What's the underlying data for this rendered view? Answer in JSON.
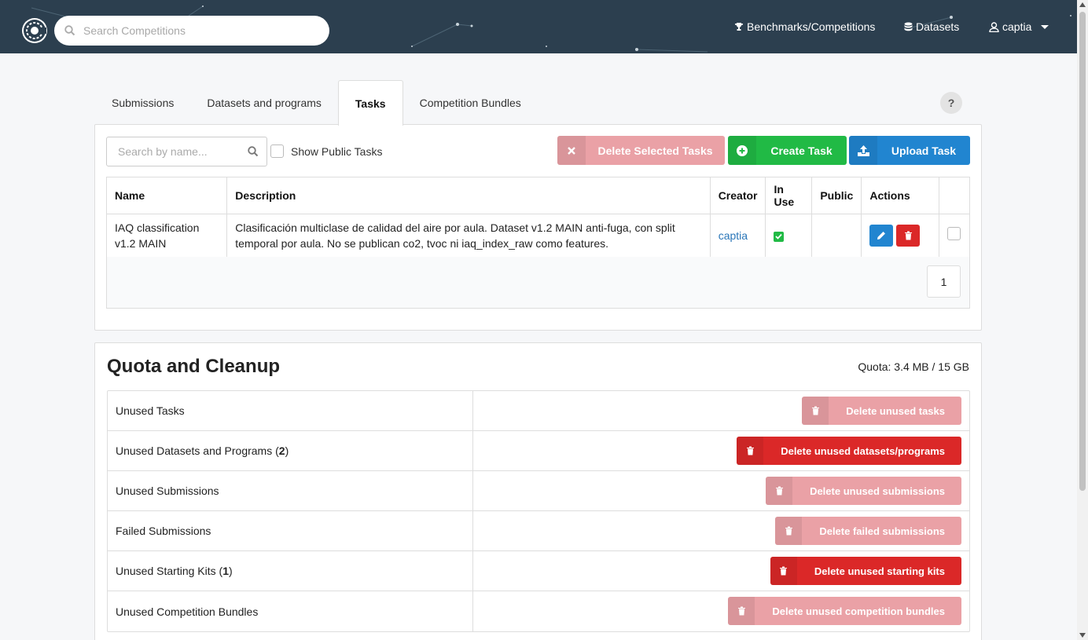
{
  "header": {
    "search_placeholder": "Search Competitions",
    "nav_benchmarks": "Benchmarks/Competitions",
    "nav_datasets": "Datasets",
    "user": "captia"
  },
  "tabs": [
    {
      "label": "Submissions",
      "active": false
    },
    {
      "label": "Datasets and programs",
      "active": false
    },
    {
      "label": "Tasks",
      "active": true
    },
    {
      "label": "Competition Bundles",
      "active": false
    }
  ],
  "help_label": "?",
  "tasks_panel": {
    "search_placeholder": "Search by name...",
    "show_public_label": "Show Public Tasks",
    "show_public_checked": false,
    "delete_selected_label": "Delete Selected Tasks",
    "create_label": "Create Task",
    "upload_label": "Upload Task",
    "columns": [
      "Name",
      "Description",
      "Creator",
      "In Use",
      "Public",
      "Actions"
    ],
    "rows": [
      {
        "name": "IAQ classification v1.2 MAIN",
        "description": "Clasificación multiclase de calidad del aire por aula. Dataset v1.2 MAIN anti-fuga, con split temporal por aula. No se publican co2, tvoc ni iaq_index_raw como features.",
        "creator": "captia",
        "in_use": true,
        "public": false,
        "selected": false
      }
    ],
    "page": "1"
  },
  "quota": {
    "title": "Quota and Cleanup",
    "value": "Quota: 3.4 MB / 15 GB",
    "rows": [
      {
        "label": "Unused Tasks",
        "count": "",
        "button": "Delete unused tasks",
        "enabled": false
      },
      {
        "label": "Unused Datasets and Programs",
        "count": "2",
        "button": "Delete unused datasets/programs",
        "enabled": true
      },
      {
        "label": "Unused Submissions",
        "count": "",
        "button": "Delete unused submissions",
        "enabled": false
      },
      {
        "label": "Failed Submissions",
        "count": "",
        "button": "Delete failed submissions",
        "enabled": false
      },
      {
        "label": "Unused Starting Kits",
        "count": "1",
        "button": "Delete unused starting kits",
        "enabled": true
      },
      {
        "label": "Unused Competition Bundles",
        "count": "",
        "button": "Delete unused competition bundles",
        "enabled": false
      }
    ]
  },
  "colors": {
    "header_bg": "#2c3f4f",
    "green": "#21ba45",
    "blue": "#2185d0",
    "red": "#db2828",
    "red_disabled": "#eaa1a6"
  }
}
